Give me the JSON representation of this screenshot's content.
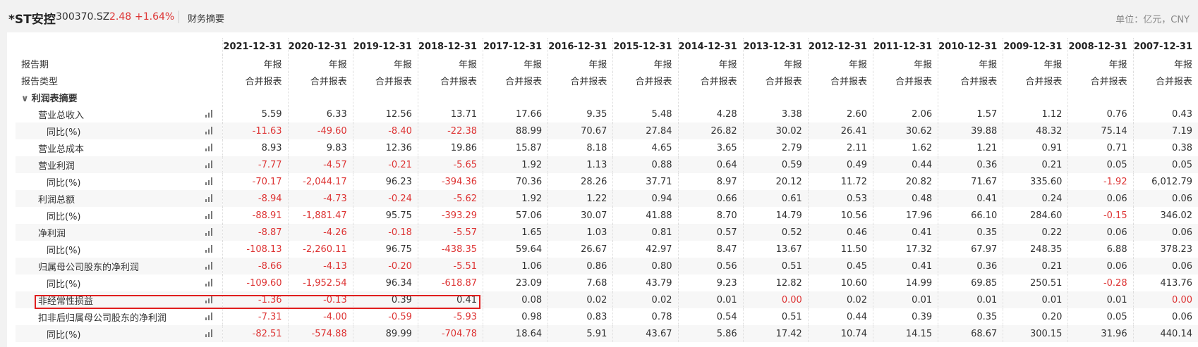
{
  "header": {
    "stock_name": "*ST安控",
    "stock_code": "300370.SZ",
    "price": "2.48",
    "change": "+1.64%",
    "title": "财务摘要",
    "unit": "单位：亿元，CNY"
  },
  "table": {
    "periods": [
      "2021-12-31",
      "2020-12-31",
      "2019-12-31",
      "2018-12-31",
      "2017-12-31",
      "2016-12-31",
      "2015-12-31",
      "2014-12-31",
      "2013-12-31",
      "2012-12-31",
      "2011-12-31",
      "2010-12-31",
      "2009-12-31",
      "2008-12-31",
      "2007-12-31"
    ],
    "period_label": "报告期",
    "type_label": "报告类型",
    "annual": "年报",
    "consolidated": "合并报表",
    "section": "利润表摘要",
    "rows": [
      {
        "label": "营业总收入",
        "sub": false,
        "values": [
          "5.59",
          "6.33",
          "12.56",
          "13.71",
          "17.66",
          "9.35",
          "5.48",
          "4.28",
          "3.38",
          "2.60",
          "2.06",
          "1.57",
          "1.12",
          "0.76",
          "0.43"
        ],
        "neg": [
          0,
          0,
          0,
          0,
          0,
          0,
          0,
          0,
          0,
          0,
          0,
          0,
          0,
          0,
          0
        ]
      },
      {
        "label": "同比(%)",
        "sub": true,
        "values": [
          "-11.63",
          "-49.60",
          "-8.40",
          "-22.38",
          "88.99",
          "70.67",
          "27.84",
          "26.82",
          "30.02",
          "26.41",
          "30.62",
          "39.88",
          "48.32",
          "75.14",
          "7.19"
        ],
        "neg": [
          1,
          1,
          1,
          1,
          0,
          0,
          0,
          0,
          0,
          0,
          0,
          0,
          0,
          0,
          0
        ]
      },
      {
        "label": "营业总成本",
        "sub": false,
        "values": [
          "8.93",
          "9.83",
          "12.36",
          "19.86",
          "15.87",
          "8.18",
          "4.65",
          "3.65",
          "2.79",
          "2.11",
          "1.62",
          "1.21",
          "0.91",
          "0.71",
          "0.38"
        ],
        "neg": [
          0,
          0,
          0,
          0,
          0,
          0,
          0,
          0,
          0,
          0,
          0,
          0,
          0,
          0,
          0
        ]
      },
      {
        "label": "营业利润",
        "sub": false,
        "values": [
          "-7.77",
          "-4.57",
          "-0.21",
          "-5.65",
          "1.92",
          "1.13",
          "0.88",
          "0.64",
          "0.59",
          "0.49",
          "0.44",
          "0.36",
          "0.21",
          "0.05",
          "0.05"
        ],
        "neg": [
          1,
          1,
          1,
          1,
          0,
          0,
          0,
          0,
          0,
          0,
          0,
          0,
          0,
          0,
          0
        ]
      },
      {
        "label": "同比(%)",
        "sub": true,
        "values": [
          "-70.17",
          "-2,044.17",
          "96.23",
          "-394.36",
          "70.36",
          "28.26",
          "37.71",
          "8.97",
          "20.12",
          "11.72",
          "20.82",
          "71.67",
          "335.60",
          "-1.92",
          "6,012.79"
        ],
        "neg": [
          1,
          1,
          0,
          1,
          0,
          0,
          0,
          0,
          0,
          0,
          0,
          0,
          0,
          1,
          0
        ]
      },
      {
        "label": "利润总额",
        "sub": false,
        "values": [
          "-8.94",
          "-4.73",
          "-0.24",
          "-5.62",
          "1.92",
          "1.22",
          "0.94",
          "0.66",
          "0.61",
          "0.53",
          "0.48",
          "0.41",
          "0.24",
          "0.06",
          "0.06"
        ],
        "neg": [
          1,
          1,
          1,
          1,
          0,
          0,
          0,
          0,
          0,
          0,
          0,
          0,
          0,
          0,
          0
        ]
      },
      {
        "label": "同比(%)",
        "sub": true,
        "values": [
          "-88.91",
          "-1,881.47",
          "95.75",
          "-393.29",
          "57.06",
          "30.07",
          "41.88",
          "8.70",
          "14.79",
          "10.56",
          "17.96",
          "66.10",
          "284.60",
          "-0.15",
          "346.02"
        ],
        "neg": [
          1,
          1,
          0,
          1,
          0,
          0,
          0,
          0,
          0,
          0,
          0,
          0,
          0,
          1,
          0
        ]
      },
      {
        "label": "净利润",
        "sub": false,
        "values": [
          "-8.87",
          "-4.26",
          "-0.18",
          "-5.57",
          "1.65",
          "1.03",
          "0.81",
          "0.57",
          "0.52",
          "0.46",
          "0.41",
          "0.35",
          "0.22",
          "0.06",
          "0.06"
        ],
        "neg": [
          1,
          1,
          1,
          1,
          0,
          0,
          0,
          0,
          0,
          0,
          0,
          0,
          0,
          0,
          0
        ]
      },
      {
        "label": "同比(%)",
        "sub": true,
        "values": [
          "-108.13",
          "-2,260.11",
          "96.75",
          "-438.35",
          "59.64",
          "26.67",
          "42.97",
          "8.47",
          "13.67",
          "11.50",
          "17.32",
          "67.97",
          "248.35",
          "6.88",
          "378.23"
        ],
        "neg": [
          1,
          1,
          0,
          1,
          0,
          0,
          0,
          0,
          0,
          0,
          0,
          0,
          0,
          0,
          0
        ]
      },
      {
        "label": "归属母公司股东的净利润",
        "sub": false,
        "values": [
          "-8.66",
          "-4.13",
          "-0.20",
          "-5.51",
          "1.06",
          "0.86",
          "0.80",
          "0.56",
          "0.51",
          "0.45",
          "0.41",
          "0.36",
          "0.21",
          "0.06",
          "0.06"
        ],
        "neg": [
          1,
          1,
          1,
          1,
          0,
          0,
          0,
          0,
          0,
          0,
          0,
          0,
          0,
          0,
          0
        ]
      },
      {
        "label": "同比(%)",
        "sub": true,
        "values": [
          "-109.60",
          "-1,952.54",
          "96.34",
          "-618.87",
          "23.09",
          "7.68",
          "43.79",
          "9.23",
          "12.82",
          "10.60",
          "14.99",
          "69.85",
          "250.51",
          "-0.28",
          "413.76"
        ],
        "neg": [
          1,
          1,
          0,
          1,
          0,
          0,
          0,
          0,
          0,
          0,
          0,
          0,
          0,
          1,
          0
        ]
      },
      {
        "label": "非经常性损益",
        "sub": false,
        "values": [
          "-1.36",
          "-0.13",
          "0.39",
          "0.41",
          "0.08",
          "0.02",
          "0.02",
          "0.01",
          "0.00",
          "0.02",
          "0.01",
          "0.01",
          "0.01",
          "0.01",
          "0.00"
        ],
        "neg": [
          1,
          1,
          0,
          0,
          0,
          0,
          0,
          0,
          1,
          0,
          0,
          0,
          0,
          0,
          1
        ]
      },
      {
        "label": "扣非后归属母公司股东的净利润",
        "sub": false,
        "values": [
          "-7.31",
          "-4.00",
          "-0.59",
          "-5.93",
          "0.98",
          "0.83",
          "0.78",
          "0.54",
          "0.51",
          "0.44",
          "0.39",
          "0.35",
          "0.20",
          "0.05",
          "0.06"
        ],
        "neg": [
          1,
          1,
          1,
          1,
          0,
          0,
          0,
          0,
          0,
          0,
          0,
          0,
          0,
          0,
          0
        ]
      },
      {
        "label": "同比(%)",
        "sub": true,
        "values": [
          "-82.51",
          "-574.88",
          "89.99",
          "-704.78",
          "18.64",
          "5.91",
          "43.67",
          "5.86",
          "17.42",
          "10.74",
          "14.15",
          "68.67",
          "300.15",
          "31.96",
          "440.14"
        ],
        "neg": [
          1,
          1,
          0,
          1,
          0,
          0,
          0,
          0,
          0,
          0,
          0,
          0,
          0,
          0,
          0
        ]
      }
    ]
  }
}
